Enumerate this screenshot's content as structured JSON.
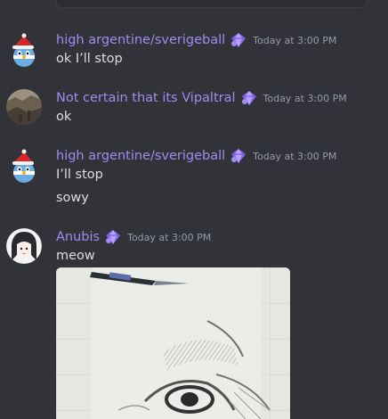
{
  "messages": [
    {
      "username": "high argentine/sverigeball",
      "timestamp": "Today at 3:00 PM",
      "lines": [
        "ok I’ll stop"
      ],
      "avatar": "christmas-countryball-icon",
      "badge": "nitro-gem-icon"
    },
    {
      "username": "Not certain that its Vipaltral",
      "timestamp": "Today at 3:00 PM",
      "lines": [
        "ok"
      ],
      "avatar": "landscape-photo-icon",
      "badge": "nitro-gem-icon"
    },
    {
      "username": "high argentine/sverigeball",
      "timestamp": "Today at 3:00 PM",
      "lines": [
        "I’ll stop",
        "sowy"
      ],
      "avatar": "christmas-countryball-icon",
      "badge": "nitro-gem-icon"
    },
    {
      "username": "Anubis",
      "timestamp": "Today at 3:00 PM",
      "lines": [
        "meow"
      ],
      "avatar": "anime-character-icon",
      "badge": "nitro-gem-icon",
      "attachment": "pencil-sketch-image"
    }
  ],
  "colors": {
    "background": "#313338",
    "username": "#a18bf0",
    "timestamp": "#949ba4",
    "text": "#dbdee1"
  }
}
